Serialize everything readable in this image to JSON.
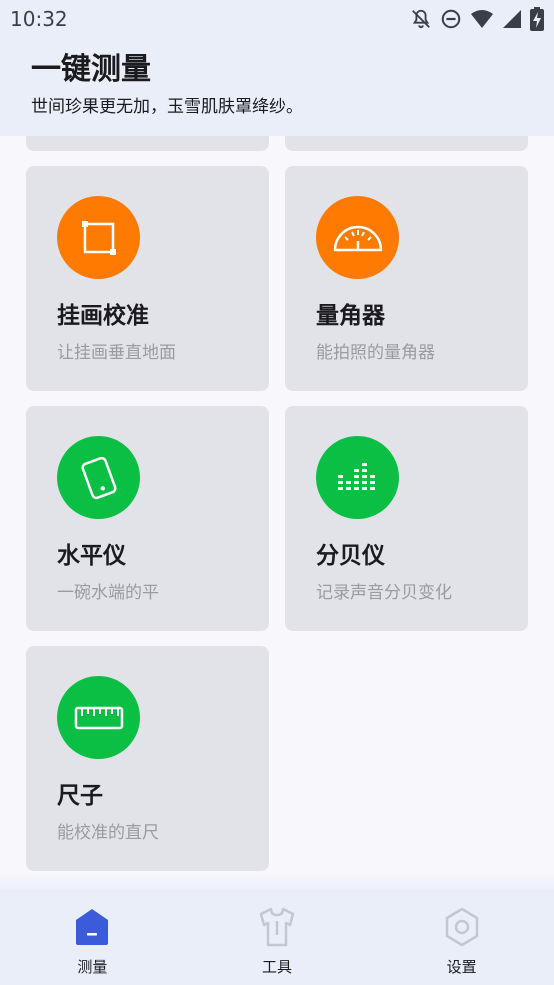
{
  "status_bar": {
    "time": "10:32",
    "icons": [
      "notifications-off-icon",
      "do-not-disturb-icon",
      "wifi-icon",
      "signal-icon",
      "battery-charging-icon"
    ]
  },
  "header": {
    "title": "一键测量",
    "subtitle": "世间珍果更无加，玉雪肌肤罩绛纱。"
  },
  "tools": [
    {
      "title": "挂画校准",
      "desc": "让挂画垂直地面",
      "icon": "frame-icon",
      "color": "#ff7a00"
    },
    {
      "title": "量角器",
      "desc": "能拍照的量角器",
      "icon": "protractor-icon",
      "color": "#ff7a00"
    },
    {
      "title": "水平仪",
      "desc": "一碗水端的平",
      "icon": "phone-level-icon",
      "color": "#0bbf45"
    },
    {
      "title": "分贝仪",
      "desc": "记录声音分贝变化",
      "icon": "decibel-bars-icon",
      "color": "#0bbf45"
    },
    {
      "title": "尺子",
      "desc": "能校准的直尺",
      "icon": "ruler-icon",
      "color": "#0bbf45"
    }
  ],
  "bottom_nav": {
    "items": [
      {
        "label": "测量",
        "icon": "home-icon",
        "active": true
      },
      {
        "label": "工具",
        "icon": "shirt-icon",
        "active": false
      },
      {
        "label": "设置",
        "icon": "gear-icon",
        "active": false
      }
    ],
    "active_color": "#3b5bdb",
    "inactive_color": "#c3c7d0"
  }
}
